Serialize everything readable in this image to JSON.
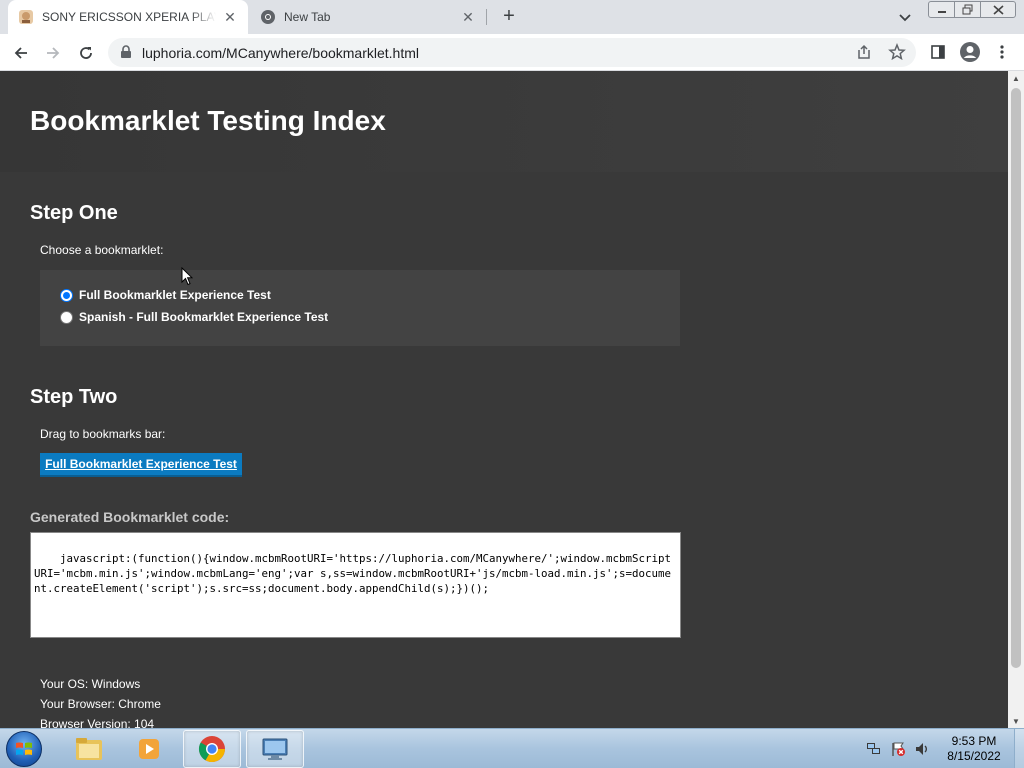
{
  "browser": {
    "tabs": [
      {
        "title": "SONY ERICSSON XPERIA PLAY M",
        "active": true,
        "icon": "photo-favicon"
      },
      {
        "title": "New Tab",
        "active": false,
        "icon": "chrome-favicon"
      }
    ],
    "address_url": "luphoria.com/MCanywhere/bookmarklet.html"
  },
  "page": {
    "title": "Bookmarklet Testing Index",
    "step_one": {
      "heading": "Step One",
      "instruction": "Choose a bookmarklet:",
      "options": [
        {
          "label": "Full Bookmarklet Experience Test",
          "selected": true
        },
        {
          "label": "Spanish - Full Bookmarklet Experience Test",
          "selected": false
        }
      ]
    },
    "step_two": {
      "heading": "Step Two",
      "instruction": "Drag to bookmarks bar:",
      "bookmarklet_link": "Full Bookmarklet Experience Test"
    },
    "code_label": "Generated Bookmarklet code:",
    "code": "javascript:(function(){window.mcbmRootURI='https://luphoria.com/MCanywhere/';window.mcbmScriptURI='mcbm.min.js';window.mcbmLang='eng';var s,ss=window.mcbmRootURI+'js/mcbm-load.min.js';s=document.createElement('script');s.src=ss;document.body.appendChild(s);})();",
    "info": {
      "os": "Your OS: Windows",
      "browser": "Your Browser: Chrome",
      "version": "Browser Version: 104"
    }
  },
  "taskbar": {
    "clock_time": "9:53 PM",
    "clock_date": "8/15/2022"
  },
  "colors": {
    "page_bg": "#393939",
    "link_button": "#0b7bc1",
    "radio_accent": "#0075ff"
  }
}
